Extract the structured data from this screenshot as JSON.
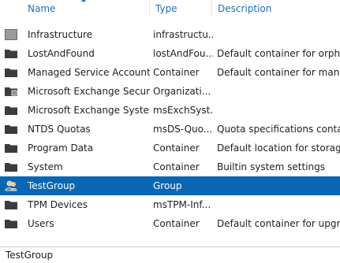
{
  "columns": {
    "name": "Name",
    "type": "Type",
    "description": "Description"
  },
  "rows": [
    {
      "icon": "domain-object-icon",
      "name": "Infrastructure",
      "type": "infrastructu...",
      "description": ""
    },
    {
      "icon": "folder-icon",
      "name": "LostAndFound",
      "type": "lostAndFou...",
      "description": "Default container for orph..."
    },
    {
      "icon": "folder-icon",
      "name": "Managed Service Accounts",
      "type": "Container",
      "description": "Default container for man..."
    },
    {
      "icon": "organization-icon",
      "name": "Microsoft Exchange Securi...",
      "type": "Organizati...",
      "description": ""
    },
    {
      "icon": "folder-icon",
      "name": "Microsoft Exchange Syste...",
      "type": "msExchSyst...",
      "description": ""
    },
    {
      "icon": "folder-icon",
      "name": "NTDS Quotas",
      "type": "msDS-Quo...",
      "description": "Quota specifications conta..."
    },
    {
      "icon": "folder-icon",
      "name": "Program Data",
      "type": "Container",
      "description": "Default location for storag..."
    },
    {
      "icon": "folder-icon",
      "name": "System",
      "type": "Container",
      "description": "Builtin system settings"
    },
    {
      "icon": "group-icon",
      "name": "TestGroup",
      "type": "Group",
      "description": "",
      "selected": true
    },
    {
      "icon": "folder-icon",
      "name": "TPM Devices",
      "type": "msTPM-Inf...",
      "description": ""
    },
    {
      "icon": "folder-icon",
      "name": "Users",
      "type": "Container",
      "description": "Default container for upgr..."
    }
  ],
  "status_bar": {
    "text": "TestGroup"
  },
  "colors": {
    "selection": "#0a66b3",
    "header_text": "#1f6fb5"
  }
}
